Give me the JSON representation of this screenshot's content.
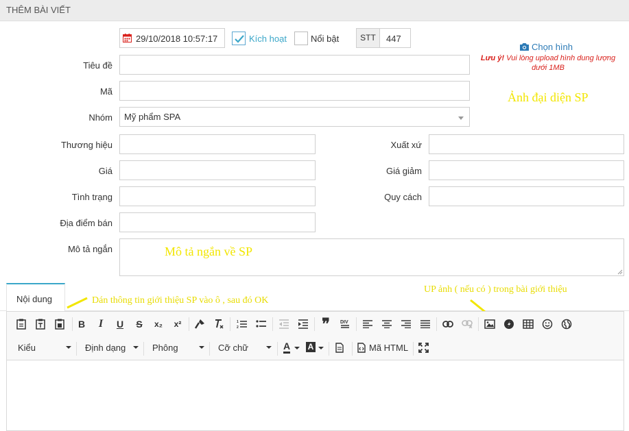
{
  "header": {
    "title": "THÊM BÀI VIẾT"
  },
  "top": {
    "date": "29/10/2018 10:57:17",
    "active_label": "Kích hoạt",
    "featured_label": "Nổi bật",
    "stt_label": "STT",
    "stt_value": "447"
  },
  "form": {
    "title_label": "Tiêu đề",
    "code_label": "Mã",
    "group_label": "Nhóm",
    "group_value": "Mỹ phẩm SPA",
    "brand_label": "Thương hiệu",
    "origin_label": "Xuất xứ",
    "price_label": "Giá",
    "sale_price_label": "Giá giảm",
    "condition_label": "Tình trạng",
    "spec_label": "Quy cách",
    "location_label": "Địa điểm bán",
    "short_desc_label": "Mô tả ngắn"
  },
  "image": {
    "choose_label": "Chọn hình",
    "note_prefix": "Lưu ý!",
    "note_line1": "Vui lòng upload hình dung lượng",
    "note_line2": "dưới 1MB"
  },
  "annotations": {
    "avatar": "Ảnh đại diện SP",
    "short_desc": "Mô tả ngắn về SP",
    "paste": "Dán thông tin giới thiệu SP vào ô , sau đó OK",
    "upload": "UP ảnh ( nếu có ) trong bài giới thiệu"
  },
  "tabs": {
    "content": "Nội dung"
  },
  "toolbar": {
    "bold": "B",
    "italic": "I",
    "underline": "U",
    "strike": "S",
    "subscript": "x₂",
    "superscript": "x²",
    "quote": "❞",
    "style": "Kiểu",
    "format": "Định dạng",
    "font": "Phông",
    "size": "Cỡ chữ",
    "font_color": "A",
    "bg_color": "A",
    "html_label": "Mã HTML"
  },
  "colors": {
    "accent": "#3ba7c9",
    "warning_red": "#d9211c",
    "annotation_yellow": "#f2e600",
    "link_blue": "#2c7ab6"
  }
}
